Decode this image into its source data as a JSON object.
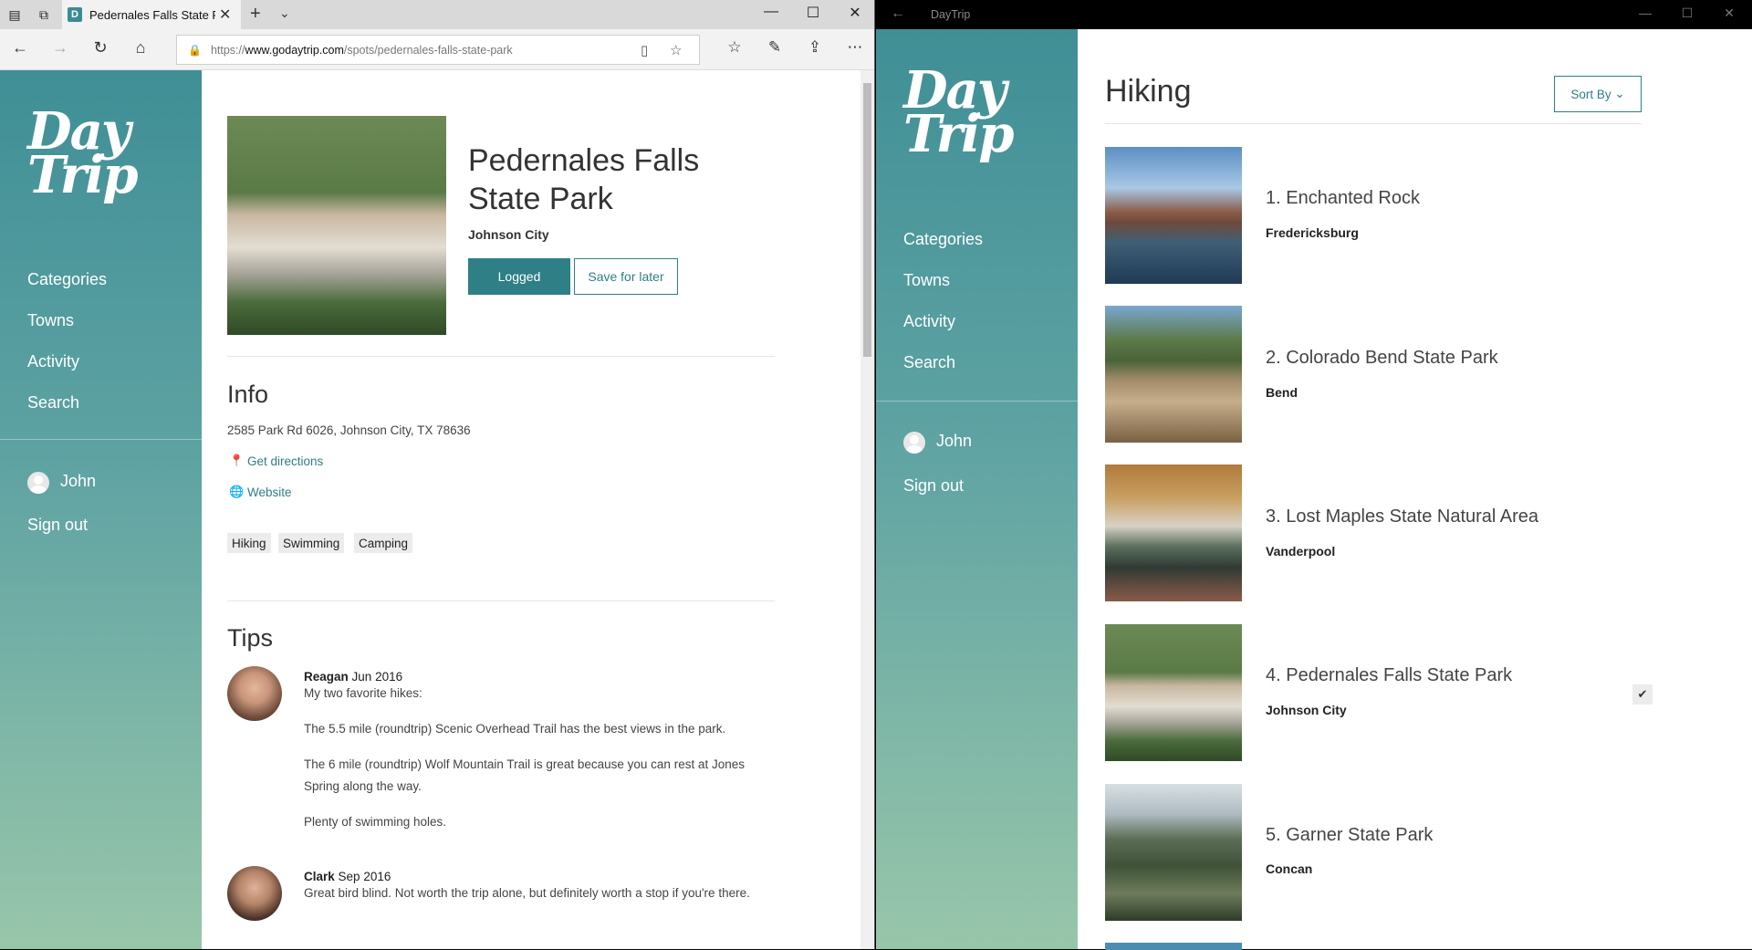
{
  "browser": {
    "tab_title": "Pedernales Falls State Pa",
    "url_prefix": "https://",
    "url_domain": "www.godaytrip.com",
    "url_path": "/spots/pedernales-falls-state-park"
  },
  "site": {
    "logo": "Day Trip",
    "nav": [
      "Categories",
      "Towns",
      "Activity",
      "Search"
    ],
    "user": "John",
    "sign_out": "Sign out"
  },
  "spot": {
    "title": "Pedernales Falls State Park",
    "city": "Johnson City",
    "logged_label": "Logged",
    "save_label": "Save for later",
    "info_heading": "Info",
    "address": "2585 Park Rd 6026, Johnson City, TX 78636",
    "directions": "Get directions",
    "website": "Website",
    "tags": [
      "Hiking",
      "Swimming",
      "Camping"
    ],
    "tips_heading": "Tips",
    "tips": [
      {
        "name": "Reagan",
        "date": "Jun 2016",
        "paragraphs": [
          "My two favorite hikes:",
          "The 5.5 mile (roundtrip) Scenic Overhead Trail has the best views in the park.",
          "The 6 mile (roundtrip) Wolf Mountain Trail is great because you can rest at Jones Spring along the way.",
          "Plenty of swimming holes."
        ]
      },
      {
        "name": "Clark",
        "date": "Sep 2016",
        "paragraphs": [
          "Great bird blind. Not worth the trip alone, but definitely worth a stop if you're there."
        ]
      }
    ]
  },
  "app": {
    "window_title": "DayTrip",
    "heading": "Hiking",
    "sort_label": "Sort By",
    "results": [
      {
        "title": "1. Enchanted Rock",
        "city": "Fredericksburg",
        "checked": false
      },
      {
        "title": "2. Colorado Bend State Park",
        "city": "Bend",
        "checked": false
      },
      {
        "title": "3. Lost Maples State Natural Area",
        "city": "Vanderpool",
        "checked": false
      },
      {
        "title": "4. Pedernales Falls State Park",
        "city": "Johnson City",
        "checked": true
      },
      {
        "title": "5. Garner State Park",
        "city": "Concan",
        "checked": false
      }
    ]
  },
  "colors": {
    "accent": "#2e7f86",
    "sidebar_top": "#3f8f96",
    "sidebar_bottom": "#98c6aa"
  }
}
